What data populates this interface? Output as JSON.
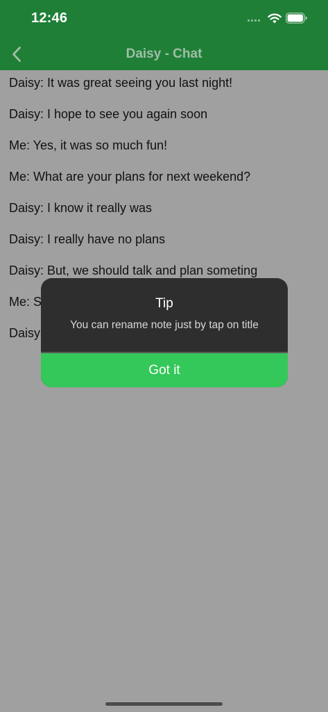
{
  "status_bar": {
    "time": "12:46"
  },
  "nav": {
    "title": "Daisy - Chat",
    "back_icon": "chevron-left-icon"
  },
  "messages": [
    "Daisy: It was great seeing you last night!",
    "Daisy: I hope to see you again soon",
    "Me: Yes, it was so much fun!",
    "Me: What are your plans for next weekend?",
    "Daisy: I know it really was",
    "Daisy: I really have no plans",
    "Daisy: But, we should talk and plan someting",
    "Me: S",
    "Daisy"
  ],
  "tip": {
    "title": "Tip",
    "message": "You can rename note just by tap on title",
    "button_label": "Got it"
  },
  "colors": {
    "header_green": "#1f7f37",
    "accent_green": "#34c759",
    "dialog_bg": "#2e2e2e",
    "overlay_gray": "#a0a0a0"
  }
}
